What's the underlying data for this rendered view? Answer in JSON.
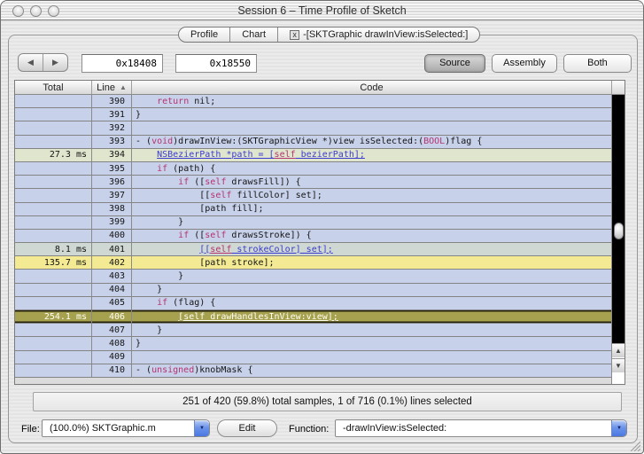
{
  "window": {
    "title": "Session 6 – Time Profile of Sketch"
  },
  "tabs": {
    "profile": "Profile",
    "chart": "Chart",
    "session": "-[SKTGraphic drawInView:isSelected:]"
  },
  "icons": {
    "back": "◀",
    "forward": "▶",
    "sort_asc": "▲",
    "popup_arrow": "▼",
    "scroll_up": "▲",
    "scroll_down": "▼",
    "tab_close": "x"
  },
  "toolbar": {
    "start_address": "0x18408",
    "end_address": "0x18550",
    "source": "Source",
    "assembly": "Assembly",
    "both": "Both"
  },
  "table": {
    "columns": {
      "total": "Total",
      "line": "Line",
      "code": "Code"
    },
    "rows": [
      {
        "total": "",
        "line": "390",
        "bg": "default",
        "segs": [
          [
            "p",
            "    "
          ],
          [
            "k",
            "return"
          ],
          [
            "p",
            " nil;"
          ]
        ]
      },
      {
        "total": "",
        "line": "391",
        "bg": "default",
        "segs": [
          [
            "p",
            "}"
          ]
        ]
      },
      {
        "total": "",
        "line": "392",
        "bg": "default",
        "segs": []
      },
      {
        "total": "",
        "line": "393",
        "bg": "default",
        "segs": [
          [
            "p",
            "- ("
          ],
          [
            "k",
            "void"
          ],
          [
            "p",
            ")drawInView:(SKTGraphicView *)view isSelected:("
          ],
          [
            "k",
            "BOOL"
          ],
          [
            "p",
            ")flag {"
          ]
        ]
      },
      {
        "total": "27.3 ms",
        "line": "394",
        "bg": "green",
        "segs": [
          [
            "p",
            "    "
          ],
          [
            "l",
            "NSBezierPath *path = ["
          ],
          [
            "kl",
            "self"
          ],
          [
            "l",
            " bezierPath];"
          ]
        ]
      },
      {
        "total": "",
        "line": "395",
        "bg": "default",
        "segs": [
          [
            "p",
            "    "
          ],
          [
            "k",
            "if"
          ],
          [
            "p",
            " (path) {"
          ]
        ]
      },
      {
        "total": "",
        "line": "396",
        "bg": "default",
        "segs": [
          [
            "p",
            "        "
          ],
          [
            "k",
            "if"
          ],
          [
            "p",
            " (["
          ],
          [
            "k",
            "self"
          ],
          [
            "p",
            " drawsFill]) {"
          ]
        ]
      },
      {
        "total": "",
        "line": "397",
        "bg": "default",
        "segs": [
          [
            "p",
            "            [["
          ],
          [
            "k",
            "self"
          ],
          [
            "p",
            " fillColor] set];"
          ]
        ]
      },
      {
        "total": "",
        "line": "398",
        "bg": "default",
        "segs": [
          [
            "p",
            "            [path fill];"
          ]
        ]
      },
      {
        "total": "",
        "line": "399",
        "bg": "default",
        "segs": [
          [
            "p",
            "        }"
          ]
        ]
      },
      {
        "total": "",
        "line": "400",
        "bg": "default",
        "segs": [
          [
            "p",
            "        "
          ],
          [
            "k",
            "if"
          ],
          [
            "p",
            " (["
          ],
          [
            "k",
            "self"
          ],
          [
            "p",
            " drawsStroke]) {"
          ]
        ]
      },
      {
        "total": "8.1 ms",
        "line": "401",
        "bg": "gray",
        "segs": [
          [
            "p",
            "            "
          ],
          [
            "l",
            "[["
          ],
          [
            "kl",
            "self"
          ],
          [
            "l",
            " strokeColor] set];"
          ]
        ]
      },
      {
        "total": "135.7 ms",
        "line": "402",
        "bg": "yellow",
        "segs": [
          [
            "p",
            "            [path stroke];"
          ]
        ]
      },
      {
        "total": "",
        "line": "403",
        "bg": "default",
        "segs": [
          [
            "p",
            "        }"
          ]
        ]
      },
      {
        "total": "",
        "line": "404",
        "bg": "default",
        "segs": [
          [
            "p",
            "    }"
          ]
        ]
      },
      {
        "total": "",
        "line": "405",
        "bg": "default",
        "segs": [
          [
            "p",
            "    "
          ],
          [
            "k",
            "if"
          ],
          [
            "p",
            " (flag) {"
          ]
        ]
      },
      {
        "total": "254.1 ms",
        "line": "406",
        "bg": "selected",
        "segs": [
          [
            "p",
            "        "
          ],
          [
            "w",
            "[self drawHandlesInView:view];"
          ]
        ]
      },
      {
        "total": "",
        "line": "407",
        "bg": "default",
        "segs": [
          [
            "p",
            "    }"
          ]
        ]
      },
      {
        "total": "",
        "line": "408",
        "bg": "default",
        "segs": [
          [
            "p",
            "}"
          ]
        ]
      },
      {
        "total": "",
        "line": "409",
        "bg": "default",
        "segs": []
      },
      {
        "total": "",
        "line": "410",
        "bg": "default",
        "segs": [
          [
            "p",
            "- ("
          ],
          [
            "k",
            "unsigned"
          ],
          [
            "p",
            ")knobMask {"
          ]
        ]
      }
    ]
  },
  "status_bar": {
    "text": "251 of 420 (59.8%) total samples, 1 of 716 (0.1%) lines selected"
  },
  "footer": {
    "file_label": "File:",
    "file_value": "(100.0%) SKTGraphic.m",
    "edit_button": "Edit",
    "function_label": "Function:",
    "function_value": "-drawInView:isSelected:"
  },
  "colors": {
    "row_default": "#c7d1ea",
    "row_hot_mild": "#e0e5ce",
    "row_hot_medium": "#cfd8d3",
    "row_hot_high": "#f3ea93",
    "row_selected": "#a6a14e",
    "link": "#3b3bd0",
    "keyword": "#b53370",
    "popup_accent": "#4a76e2"
  }
}
